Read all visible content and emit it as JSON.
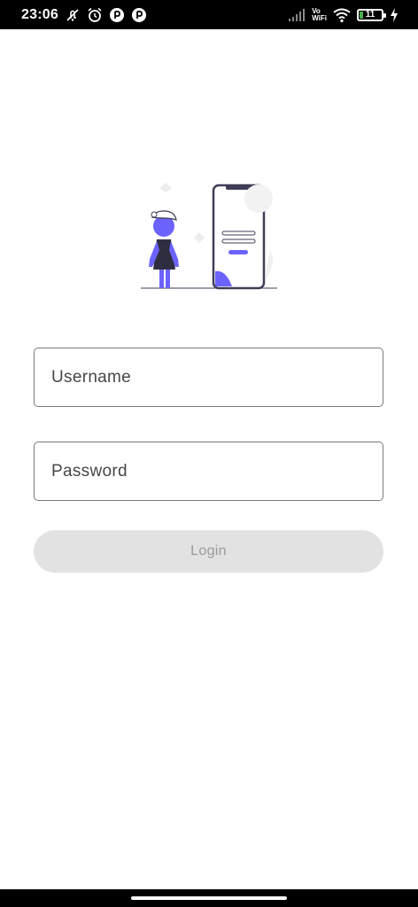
{
  "status_bar": {
    "time": "23:06",
    "left_icons": [
      "muted-notification-icon",
      "alarm-icon",
      "app-notification-icon",
      "app-notification-icon"
    ],
    "vo_label": "Vo",
    "wifi_label": "WiFi",
    "battery_level": "11",
    "right_icons": [
      "signal-icon",
      "wifi-icon",
      "battery-icon",
      "charging-icon"
    ]
  },
  "illustration": {
    "name": "login-illustration",
    "accent_color": "#6c63ff",
    "dark_color": "#2f2e41"
  },
  "form": {
    "username_placeholder": "Username",
    "username_value": "",
    "password_placeholder": "Password",
    "password_value": "",
    "login_label": "Login"
  },
  "colors": {
    "field_border": "#7a7a7e",
    "button_bg_disabled": "#e2e2e2",
    "button_text_disabled": "#9a9a9a"
  }
}
